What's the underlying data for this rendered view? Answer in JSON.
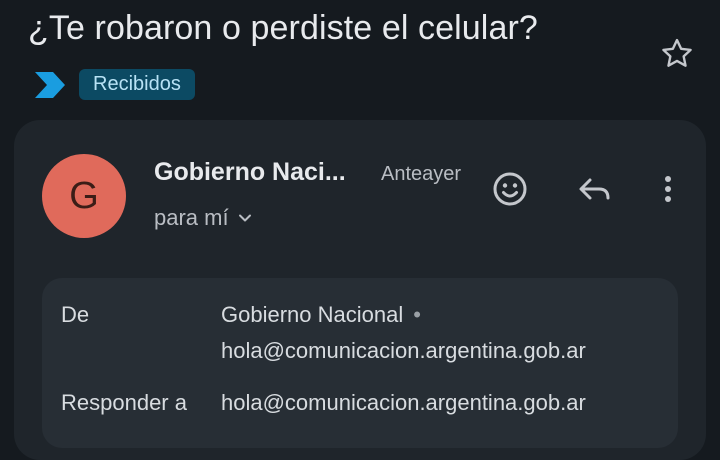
{
  "email": {
    "subject": "¿Te robaron o perdiste el celular?",
    "label": "Recibidos",
    "sender": {
      "name": "Gobierno Naci...",
      "avatar_letter": "G",
      "date": "Anteayer",
      "recipient": "para mí"
    },
    "details": {
      "from_label": "De",
      "from_name": "Gobierno Nacional",
      "from_separator": "•",
      "from_email": "hola@comunicacion.argentina.gob.ar",
      "reply_to_label": "Responder a",
      "reply_to_email": "hola@comunicacion.argentina.gob.ar"
    }
  },
  "icons": {
    "star": "star-outline-icon",
    "importance": "importance-marker-icon",
    "emoji": "emoji-reaction-icon",
    "reply": "reply-icon",
    "more": "more-vert-icon",
    "expand": "chevron-down-icon"
  },
  "colors": {
    "background": "#151a1f",
    "card": "#1f252b",
    "details_panel": "#272e35",
    "avatar": "#e06a5b",
    "label_chip": "#0c4a63",
    "importance": "#1a9de0"
  }
}
